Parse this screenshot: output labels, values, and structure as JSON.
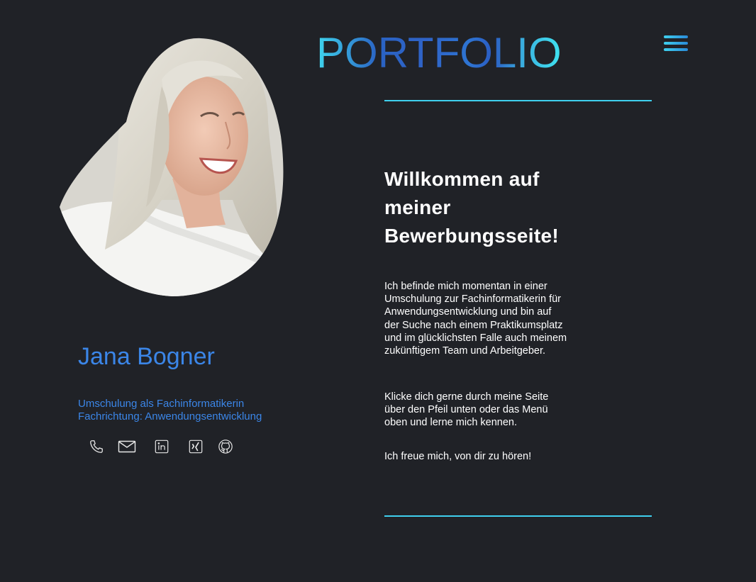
{
  "header": {
    "title": "PORTFOLIO",
    "menu_icon": "hamburger-menu-icon"
  },
  "profile": {
    "name": "Jana Bogner",
    "subtitle_line1": "Umschulung als Fachinformatikerin",
    "subtitle_line2": "Fachrichtung: Anwendungsentwicklung",
    "photo_alt": "Portrait photo"
  },
  "social": [
    {
      "icon": "phone-icon",
      "label": "Telefon"
    },
    {
      "icon": "mail-icon",
      "label": "E-Mail"
    },
    {
      "icon": "linkedin-icon",
      "label": "LinkedIn"
    },
    {
      "icon": "xing-icon",
      "label": "Xing"
    },
    {
      "icon": "github-icon",
      "label": "GitHub"
    }
  ],
  "main": {
    "welcome_line1": "Willkommen auf",
    "welcome_line2": "meiner",
    "welcome_line3": "Bewerbungsseite!",
    "paragraph1": "Ich befinde mich momentan in einer Umschulung zur Fachinformatikerin für Anwendungsentwicklung und bin auf der Suche nach einem Praktikumsplatz und im glücklichsten Falle auch meinem zukünftigem Team und Arbeitgeber.",
    "paragraph2": "Klicke dich gerne durch meine Seite über den Pfeil unten oder das Menü oben und lerne mich kennen.",
    "paragraph3": "Ich freue mich, von dir zu hören!"
  },
  "colors": {
    "background": "#202227",
    "accent_blue": "#3b86e8",
    "accent_cyan": "#3fd0ee",
    "text": "#ffffff"
  }
}
